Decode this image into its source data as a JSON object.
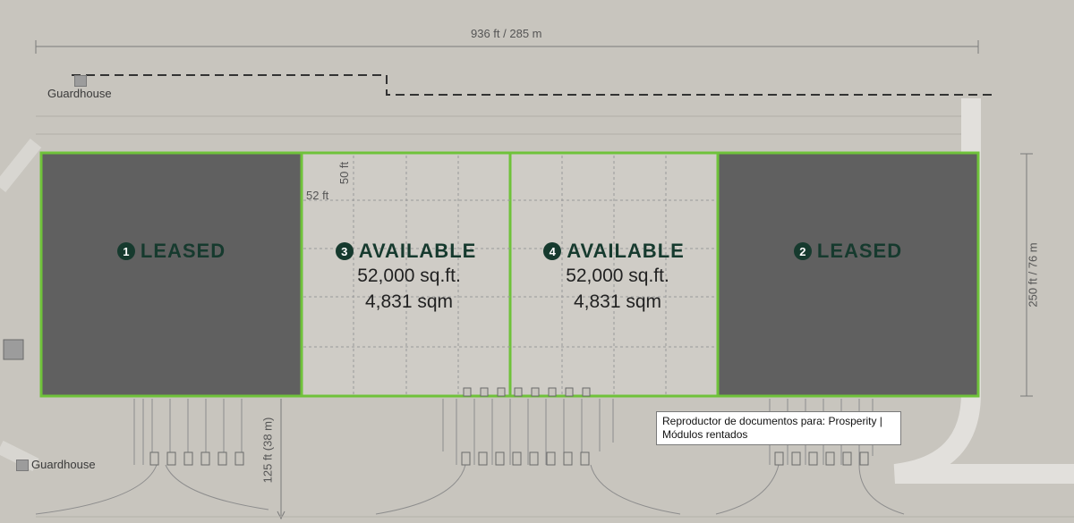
{
  "dimensions": {
    "width_label": "936 ft / 285 m",
    "height_label": "250 ft / 76 m",
    "yard_label": "125 ft (38 m)",
    "bay_width": "52 ft",
    "bay_depth": "50 ft"
  },
  "guardhouses": [
    {
      "label": "Guardhouse"
    },
    {
      "label": "Guardhouse"
    }
  ],
  "units": [
    {
      "number": "1",
      "status": "LEASED",
      "fill": "#606060"
    },
    {
      "number": "3",
      "status": "AVAILABLE",
      "area_sqft": "52,000 sq.ft.",
      "area_sqm": "4,831 sqm",
      "fill": "#cfccc6"
    },
    {
      "number": "4",
      "status": "AVAILABLE",
      "area_sqft": "52,000 sq.ft.",
      "area_sqm": "4,831 sqm",
      "fill": "#cfccc6"
    },
    {
      "number": "2",
      "status": "LEASED",
      "fill": "#606060"
    }
  ],
  "colors": {
    "outline_green": "#6fc23a",
    "background": "#c8c5be",
    "title_green": "#163a2e"
  },
  "tooltip": {
    "text": "Reproductor de documentos para: Prosperity | Módulos rentados"
  }
}
